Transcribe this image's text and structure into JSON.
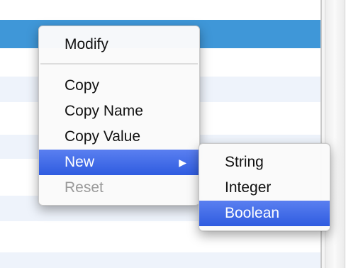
{
  "context_menu": {
    "modify": "Modify",
    "copy": "Copy",
    "copy_name": "Copy Name",
    "copy_value": "Copy Value",
    "new": "New",
    "reset": "Reset"
  },
  "submenu": {
    "string": "String",
    "integer": "Integer",
    "boolean": "Boolean"
  },
  "colors": {
    "selected_row": "#3f97d8",
    "stripe_row": "#eef3fb",
    "menu_highlight": "#3d66e6"
  },
  "icons": {
    "submenu_arrow": "triangle-right-icon"
  }
}
